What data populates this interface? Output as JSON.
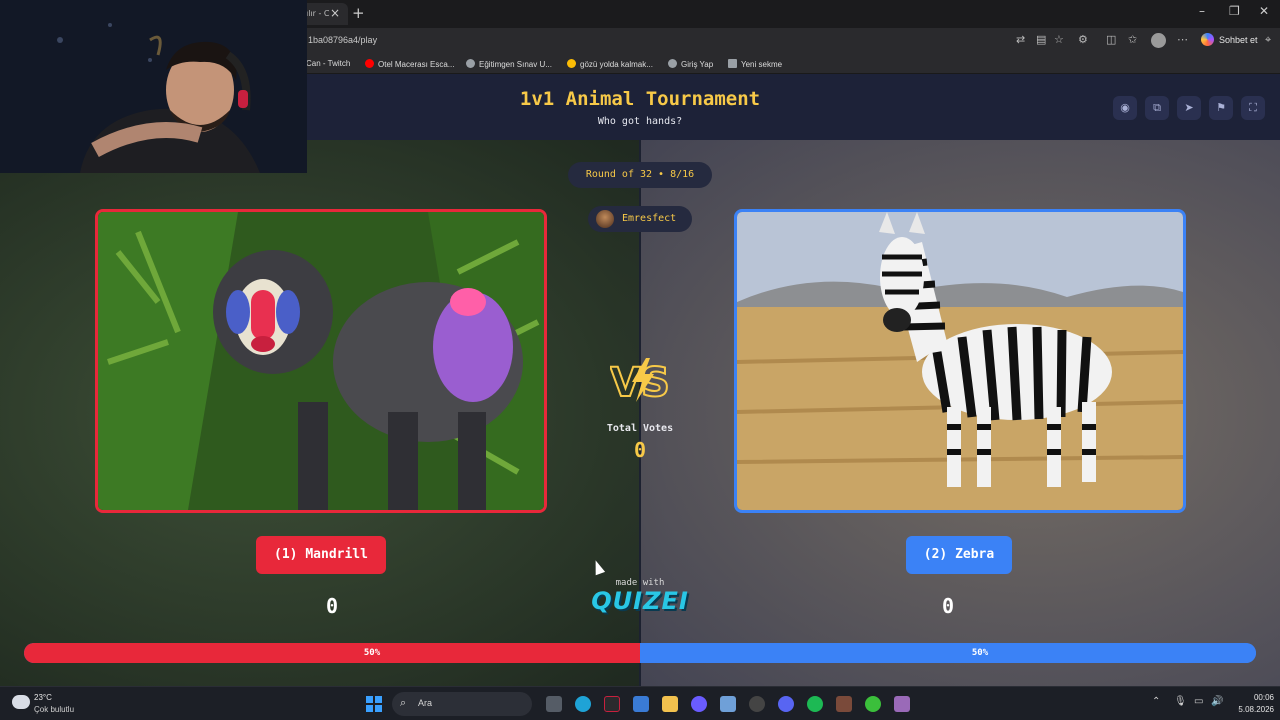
{
  "browser": {
    "tab_title": "ılır - C",
    "url": "1ba08796a4/play",
    "copilot_label": "Sohbet et",
    "bookmarks": [
      {
        "label": "Can - Twitch",
        "icon": "twitch-icon",
        "color": "#9146ff"
      },
      {
        "label": "Otel Macerası Esca...",
        "icon": "youtube-icon",
        "color": "#ff0000"
      },
      {
        "label": "Eğitimgen Sınav U...",
        "icon": "globe-icon",
        "color": "#9aa0a6"
      },
      {
        "label": "gözü yolda kalmak...",
        "icon": "google-icon",
        "color": "#fbbc05"
      },
      {
        "label": "Giriş Yap",
        "icon": "globe-icon",
        "color": "#9aa0a6"
      },
      {
        "label": "Yeni sekme",
        "icon": "page-icon",
        "color": "#9aa0a6"
      }
    ]
  },
  "app": {
    "title": "1v1 Animal Tournament",
    "subtitle": "Who got hands?",
    "round": "Round of 32 • 8/16",
    "username": "Emresfect",
    "header_icons": [
      "eye-icon",
      "share-icon",
      "send-icon",
      "flag-icon",
      "fullscreen-icon"
    ],
    "total_votes_label": "Total Votes",
    "total_votes_value": "0",
    "made_with": "made with",
    "brand": "QUIZEI",
    "left": {
      "label": "(1) Mandrill",
      "votes": "0",
      "percent_label": "50%",
      "percent": 50,
      "color": "#e8283a"
    },
    "right": {
      "label": "(2) Zebra",
      "votes": "0",
      "percent_label": "50%",
      "percent": 50,
      "color": "#3b82f6"
    }
  },
  "taskbar": {
    "weather_temp": "23°C",
    "weather_desc": "Çok bulutlu",
    "search_label": "Ara",
    "time": "00:06",
    "date": "5.08.2026"
  }
}
